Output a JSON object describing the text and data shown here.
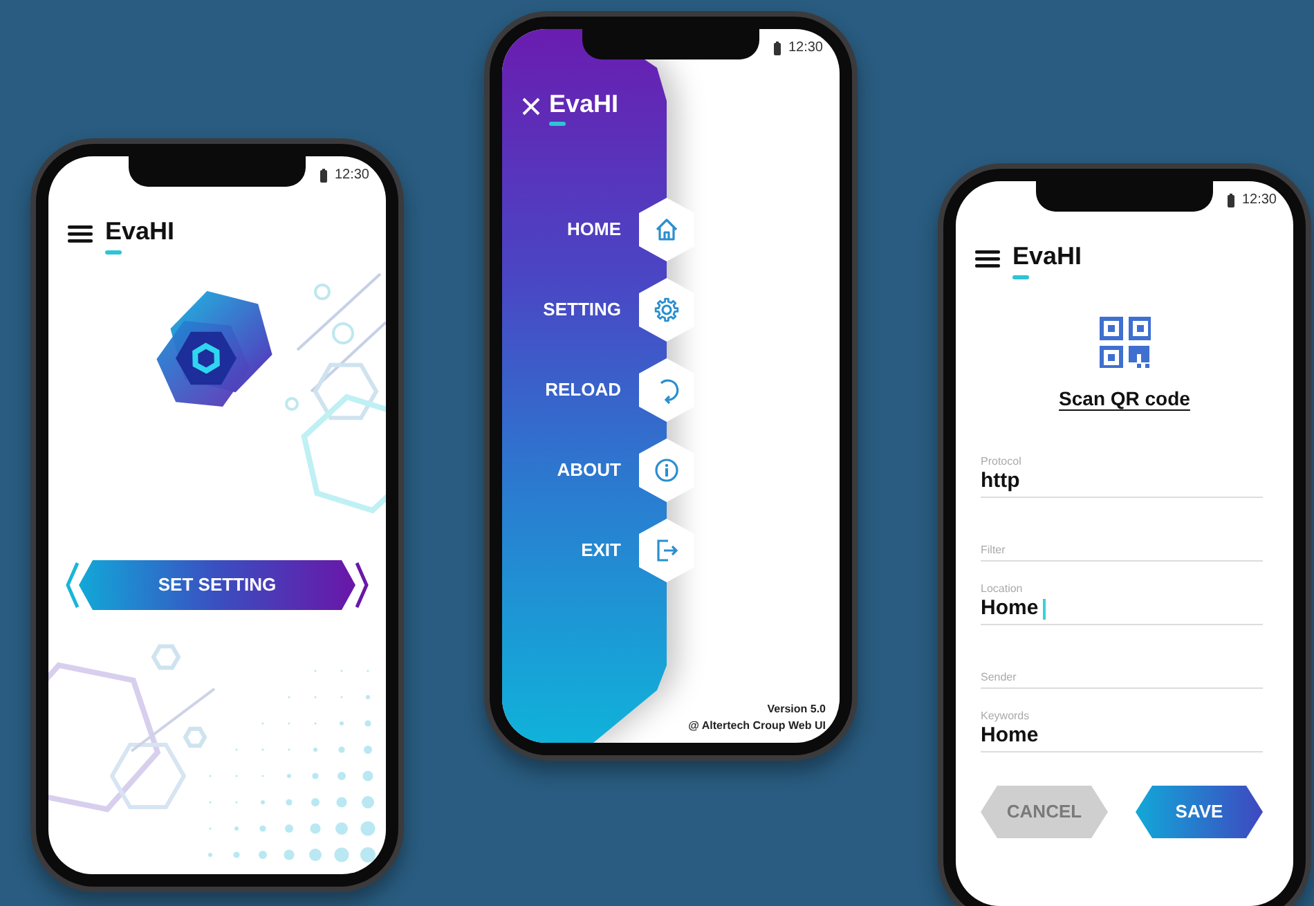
{
  "phones": [
    {
      "kind": "home",
      "status_time": "12:30",
      "app_title": "EvaHI",
      "action_button": "SET SETTING"
    },
    {
      "kind": "menu",
      "status_time": "12:30",
      "app_title": "EvaHI",
      "menu_items": [
        {
          "label": "HOME"
        },
        {
          "label": "SETTING"
        },
        {
          "label": "RELOAD"
        },
        {
          "label": "ABOUT"
        },
        {
          "label": "EXIT"
        }
      ],
      "version": "Version 5.0",
      "copyright": "@ Altertech Croup Web UI"
    },
    {
      "kind": "form",
      "status_time": "12:30",
      "app_title": "EvaHI",
      "scan_link": "Scan QR code",
      "fields": [
        {
          "label": "Protocol",
          "value": "http",
          "focused": false
        },
        {
          "label": "Filter",
          "focused": false
        },
        {
          "label": "Location",
          "value": "Home",
          "focused": true
        },
        {
          "label": "Sender",
          "focused": false
        },
        {
          "label": "Keywords",
          "value": "Home",
          "focused": false
        }
      ],
      "buttons": [
        {
          "label": "CANCEL",
          "kind": "secondary"
        },
        {
          "label": "SAVE",
          "kind": "primary"
        }
      ]
    }
  ]
}
